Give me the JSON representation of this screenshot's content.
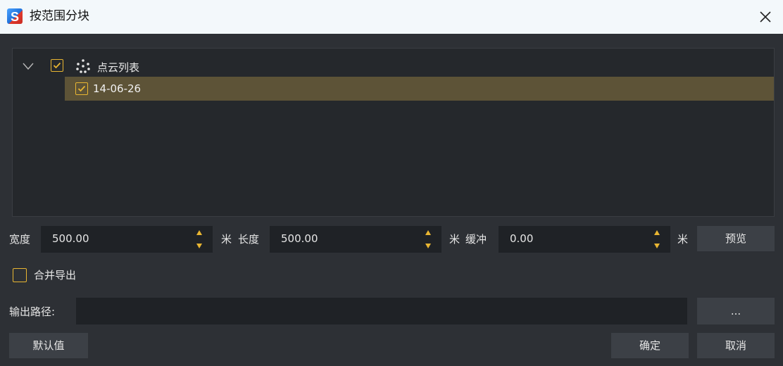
{
  "window": {
    "title": "按范围分块",
    "icon": "app-s-logo-icon",
    "close_icon": "close-icon"
  },
  "tree": {
    "root": {
      "label": "点云列表",
      "expanded": true,
      "checked": true,
      "icon": "point-cloud-dots-icon"
    },
    "children": [
      {
        "label": "14-06-26",
        "checked": true,
        "selected": true
      }
    ]
  },
  "size": {
    "width_label": "宽度",
    "width_value": "500.00",
    "width_unit": "米",
    "length_label": "长度",
    "length_value": "500.00",
    "length_unit": "米",
    "buffer_label": "缓冲",
    "buffer_value": "0.00",
    "buffer_unit": "米",
    "preview_label": "预览"
  },
  "merge": {
    "label": "合并导出",
    "checked": false
  },
  "output": {
    "label": "输出路径:",
    "value": "",
    "browse_label": "..."
  },
  "footer": {
    "default_label": "默认值",
    "ok_label": "确定",
    "cancel_label": "取消"
  },
  "colors": {
    "accent": "#e9b632",
    "selected_row": "#5d5337",
    "background": "#2d3035",
    "titlebar": "#f3f8fb"
  }
}
